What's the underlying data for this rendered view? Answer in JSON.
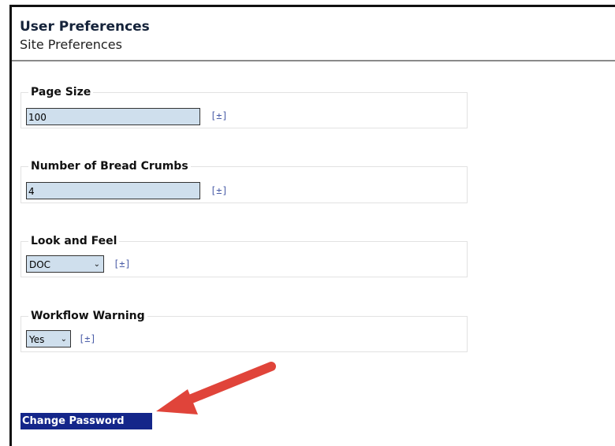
{
  "page": {
    "title": "User Preferences",
    "subtitle": "Site Preferences"
  },
  "preferences": {
    "page_size": {
      "label": "Page Size",
      "value": "100",
      "help": "[±]"
    },
    "bread_crumbs": {
      "label": "Number of Bread Crumbs",
      "value": "4",
      "help": "[±]"
    },
    "look_and_feel": {
      "label": "Look and Feel",
      "selected": "DOC",
      "help": "[±]"
    },
    "workflow_warning": {
      "label": "Workflow Warning",
      "selected": "Yes",
      "help": "[±]"
    }
  },
  "actions": {
    "change_password": "Change Password"
  },
  "colors": {
    "input_bg": "#cfdfed",
    "button_bg": "#14268a",
    "annotation_arrow": "#e0443a",
    "help_link": "#4b5ea8"
  }
}
